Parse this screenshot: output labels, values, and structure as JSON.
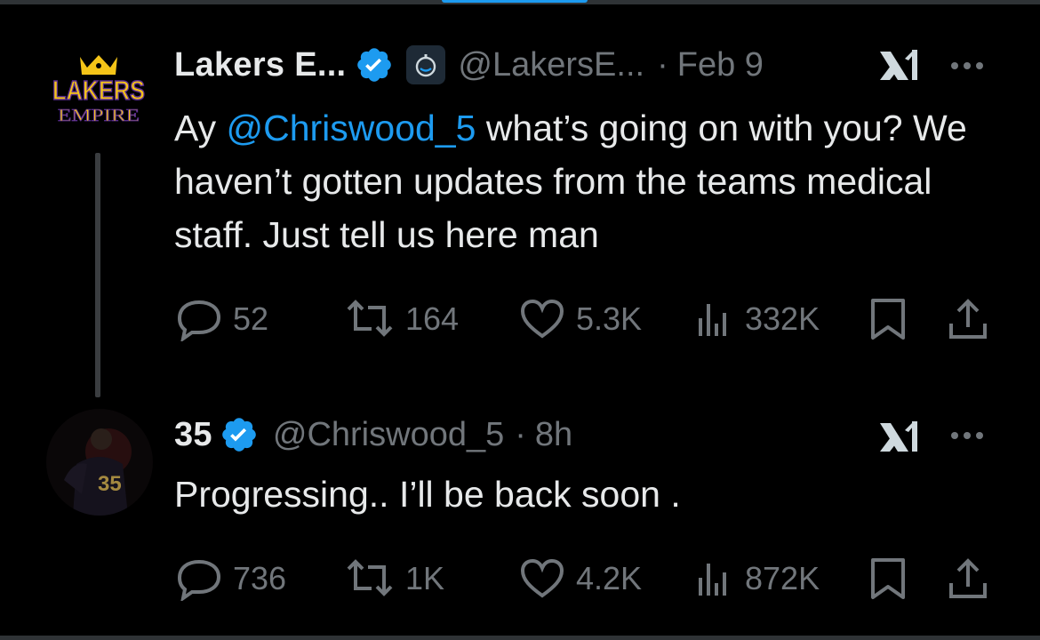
{
  "tweet1": {
    "avatar": {
      "logo_top": "LAKERS",
      "logo_bottom": "EMPIRE"
    },
    "display_name": "Lakers E...",
    "handle": "@LakersE...",
    "separator": "·",
    "time": "Feb 9",
    "text_prefix": "Ay ",
    "mention": "@Chriswood_5",
    "text_suffix": " what’s going on with you? We haven’t gotten updates from the teams medical staff. Just tell us here man",
    "stats": {
      "replies": "52",
      "reposts": "164",
      "likes": "5.3K",
      "views": "332K"
    }
  },
  "tweet2": {
    "display_name": "35",
    "handle": "@Chriswood_5",
    "separator": "·",
    "time": "8h",
    "text": "Progressing.. I’ll be back soon .",
    "stats": {
      "replies": "736",
      "reposts": "1K",
      "likes": "4.2K",
      "views": "872K"
    }
  },
  "icons": [
    "verified-badge-icon",
    "robot-badge-icon",
    "grok-icon",
    "more-icon",
    "reply-icon",
    "repost-icon",
    "like-icon",
    "views-icon",
    "bookmark-icon",
    "share-icon"
  ],
  "colors": {
    "background": "#000000",
    "text": "#e7e9ea",
    "muted": "#71767b",
    "accent": "#1d9bf0",
    "lakers_gold": "#f5c518",
    "lakers_purple": "#5a2d91"
  }
}
